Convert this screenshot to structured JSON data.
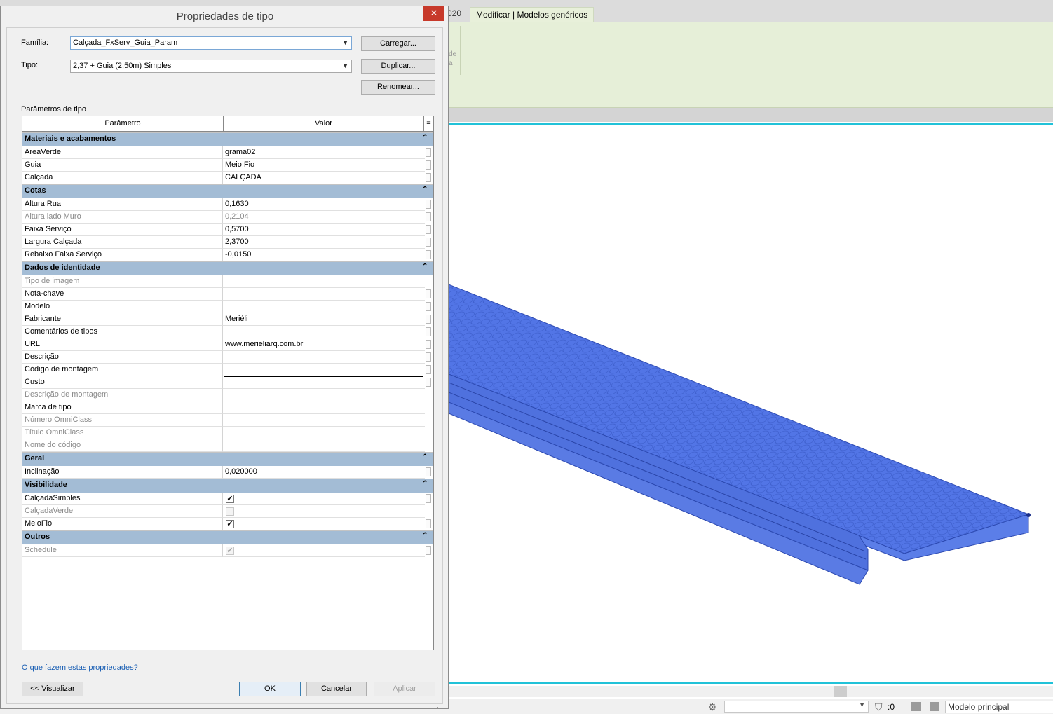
{
  "app": {
    "ribbon_partial_tab": "020",
    "ribbon_active_tab": "Modificar | Modelos genéricos",
    "ribbon_ghost_text": "de\na",
    "status_zero": ":0",
    "status_model": "Modelo principal",
    "view_highlight_color": "#21c2d8",
    "model_color": "#4a6fe0"
  },
  "dialog": {
    "title": "Propriedades de tipo",
    "close_icon": "close-icon",
    "family_label": "Família:",
    "family_value": "Calçada_FxServ_Guia_Param",
    "type_label": "Tipo:",
    "type_value": "2,37 + Guia (2,50m) Simples",
    "load_button": "Carregar...",
    "duplicate_button": "Duplicar...",
    "rename_button": "Renomear...",
    "params_label": "Parâmetros de tipo",
    "help_link": "O que fazem estas propriedades?",
    "preview_button": "<< Visualizar",
    "ok_button": "OK",
    "cancel_button": "Cancelar",
    "apply_button": "Aplicar"
  },
  "grid": {
    "col_param": "Parâmetro",
    "col_value": "Valor",
    "col_eq": "=",
    "groups": [
      {
        "name": "Materiais e acabamentos",
        "rows": [
          {
            "name": "AreaVerde",
            "value": "grama02",
            "ro": false,
            "btn": true
          },
          {
            "name": "Guia",
            "value": "Meio Fio",
            "ro": false,
            "btn": true
          },
          {
            "name": "Calçada",
            "value": "CALÇADA",
            "ro": false,
            "btn": true
          }
        ]
      },
      {
        "name": "Cotas",
        "rows": [
          {
            "name": "Altura Rua",
            "value": "0,1630",
            "ro": false,
            "btn": true
          },
          {
            "name": "Altura lado Muro",
            "value": "0,2104",
            "ro": true,
            "btn": true
          },
          {
            "name": "Faixa Serviço",
            "value": "0,5700",
            "ro": false,
            "btn": true
          },
          {
            "name": "Largura Calçada",
            "value": "2,3700",
            "ro": false,
            "btn": true
          },
          {
            "name": "Rebaixo Faixa Serviço",
            "value": "-0,0150",
            "ro": false,
            "btn": true
          }
        ]
      },
      {
        "name": "Dados de identidade",
        "rows": [
          {
            "name": "Tipo de imagem",
            "value": "",
            "ro": true,
            "btn": false
          },
          {
            "name": "Nota-chave",
            "value": "",
            "ro": false,
            "btn": true
          },
          {
            "name": "Modelo",
            "value": "",
            "ro": false,
            "btn": true
          },
          {
            "name": "Fabricante",
            "value": "Meriéli",
            "ro": false,
            "btn": true
          },
          {
            "name": "Comentários de tipos",
            "value": "",
            "ro": false,
            "btn": true
          },
          {
            "name": "URL",
            "value": "www.merieliarq.com.br",
            "ro": false,
            "btn": true
          },
          {
            "name": "Descrição",
            "value": "",
            "ro": false,
            "btn": true
          },
          {
            "name": "Código de montagem",
            "value": "",
            "ro": false,
            "btn": true
          },
          {
            "name": "Custo",
            "value": "",
            "ro": false,
            "btn": true,
            "editing": true
          },
          {
            "name": "Descrição de montagem",
            "value": "",
            "ro": true,
            "btn": false
          },
          {
            "name": "Marca de tipo",
            "value": "",
            "ro": false,
            "btn": false
          },
          {
            "name": "Número OmniClass",
            "value": "",
            "ro": true,
            "btn": false
          },
          {
            "name": "Título OmniClass",
            "value": "",
            "ro": true,
            "btn": false
          },
          {
            "name": "Nome do código",
            "value": "",
            "ro": true,
            "btn": false
          }
        ]
      },
      {
        "name": "Geral",
        "rows": [
          {
            "name": "Inclinação",
            "value": "0,020000",
            "ro": false,
            "btn": true
          }
        ]
      },
      {
        "name": "Visibilidade",
        "rows": [
          {
            "name": "CalçadaSimples",
            "check": true,
            "checked": true,
            "ro": false,
            "btn": true
          },
          {
            "name": "CalçadaVerde",
            "check": true,
            "checked": false,
            "ro": true,
            "btn": false
          },
          {
            "name": "MeioFio",
            "check": true,
            "checked": true,
            "ro": false,
            "btn": true
          }
        ]
      },
      {
        "name": "Outros",
        "rows": [
          {
            "name": "Schedule",
            "check": true,
            "checked": true,
            "ro": true,
            "btn": true
          }
        ]
      }
    ]
  }
}
